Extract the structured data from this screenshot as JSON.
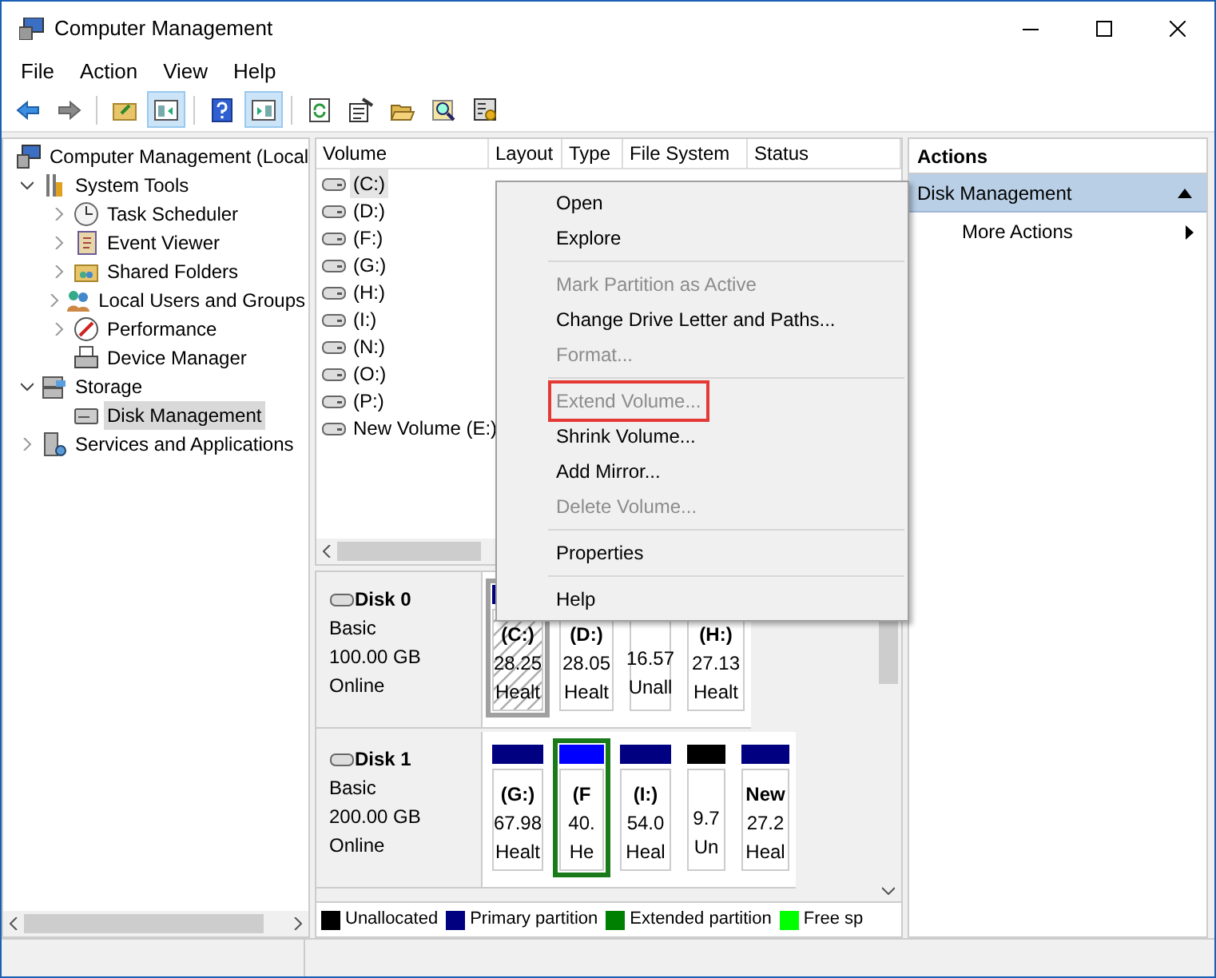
{
  "window": {
    "title": "Computer Management"
  },
  "menu_bar": [
    "File",
    "Action",
    "View",
    "Help"
  ],
  "toolbar": [
    {
      "kind": "back",
      "pressed": false
    },
    {
      "kind": "forward",
      "pressed": false
    },
    {
      "kind": "sep"
    },
    {
      "kind": "up",
      "pressed": false
    },
    {
      "kind": "tree",
      "pressed": true
    },
    {
      "kind": "sep"
    },
    {
      "kind": "help",
      "pressed": false
    },
    {
      "kind": "actionpane",
      "pressed": true
    },
    {
      "kind": "sep"
    },
    {
      "kind": "refresh",
      "pressed": false
    },
    {
      "kind": "properties",
      "pressed": false
    },
    {
      "kind": "open",
      "pressed": false
    },
    {
      "kind": "search",
      "pressed": false
    },
    {
      "kind": "settings",
      "pressed": false
    }
  ],
  "tree": [
    {
      "label": "Computer Management (Local",
      "kind": "computer",
      "selected": false,
      "children": [
        {
          "label": "System Tools",
          "kind": "tools",
          "selected": false,
          "expanded": true,
          "children": [
            {
              "label": "Task Scheduler",
              "kind": "clock",
              "selected": false,
              "expanded": false,
              "has_children": true
            },
            {
              "label": "Event Viewer",
              "kind": "book",
              "selected": false,
              "expanded": false,
              "has_children": true
            },
            {
              "label": "Shared Folders",
              "kind": "folder",
              "selected": false,
              "expanded": false,
              "has_children": true
            },
            {
              "label": "Local Users and Groups",
              "kind": "users",
              "selected": false,
              "expanded": false,
              "has_children": true
            },
            {
              "label": "Performance",
              "kind": "perf",
              "selected": false,
              "expanded": false,
              "has_children": true
            },
            {
              "label": "Device Manager",
              "kind": "device",
              "selected": false,
              "has_children": false
            }
          ]
        },
        {
          "label": "Storage",
          "kind": "storage",
          "selected": false,
          "expanded": true,
          "children": [
            {
              "label": "Disk Management",
              "kind": "disk",
              "selected": true,
              "has_children": false
            }
          ]
        },
        {
          "label": "Services and Applications",
          "kind": "services",
          "selected": false,
          "expanded": false,
          "has_children": true
        }
      ]
    }
  ],
  "volume_table": {
    "columns": [
      "Volume",
      "Layout",
      "Type",
      "File System",
      "Status"
    ],
    "rows": [
      {
        "volume": "(C:)",
        "selected": true
      },
      {
        "volume": "(D:)",
        "selected": false
      },
      {
        "volume": "(F:)",
        "selected": false
      },
      {
        "volume": "(G:)",
        "selected": false
      },
      {
        "volume": "(H:)",
        "selected": false
      },
      {
        "volume": "(I:)",
        "selected": false
      },
      {
        "volume": "(N:)",
        "selected": false
      },
      {
        "volume": "(O:)",
        "selected": false
      },
      {
        "volume": "(P:)",
        "selected": false
      },
      {
        "volume": "New Volume (E:)",
        "selected": false
      }
    ]
  },
  "disks": [
    {
      "name": "Disk 0",
      "type": "Basic",
      "size": "100.00 GB",
      "state": "Online",
      "partitions": [
        {
          "kind": "primary",
          "label": "(C:)",
          "size": "28.25",
          "status": "Healt",
          "selected": true
        },
        {
          "label": "(D:)",
          "size": "28.05",
          "status": "Healt",
          "selected": false
        },
        {
          "size": "16.57",
          "status": "Unall",
          "selected": false
        },
        {
          "label": "(H:)",
          "size": "27.13",
          "status": "Healt",
          "selected": false
        }
      ]
    },
    {
      "name": "Disk 1",
      "type": "Basic",
      "size": "200.00 GB",
      "state": "Online",
      "partitions": [
        {
          "kind": "primary",
          "label": "(G:)",
          "size": "67.98",
          "status": "Healt",
          "selected": false
        },
        {
          "kind": "logical",
          "label": "(F",
          "size": "40.",
          "status": "He",
          "selected": true
        },
        {
          "kind": "primary",
          "label": "(I:)",
          "size": "54.0",
          "status": "Heal",
          "selected": false
        },
        {
          "kind": "unallocated",
          "size": "9.7",
          "status": "Un",
          "selected": false
        },
        {
          "kind": "primary",
          "label": "New",
          "size": "27.2",
          "status": "Heal",
          "selected": false
        }
      ]
    }
  ],
  "legend": [
    {
      "label": "Unallocated",
      "color": "#000000"
    },
    {
      "label": "Primary partition",
      "color": "#000080"
    },
    {
      "label": "Extended partition",
      "color": "#008000"
    },
    {
      "label": "Free sp",
      "color": "#00ff00"
    }
  ],
  "actions": {
    "title": "Actions",
    "section": {
      "label": "Disk Management",
      "expanded": true
    },
    "items": [
      "More Actions"
    ]
  },
  "context_menu": [
    {
      "kind": "item",
      "label": "Open",
      "disabled": false,
      "outlined": false
    },
    {
      "kind": "item",
      "label": "Explore",
      "disabled": false,
      "outlined": false
    },
    {
      "kind": "separator"
    },
    {
      "kind": "item",
      "label": "Mark Partition as Active",
      "disabled": true,
      "outlined": false
    },
    {
      "kind": "item",
      "label": "Change Drive Letter and Paths...",
      "disabled": false,
      "outlined": false
    },
    {
      "kind": "item",
      "label": "Format...",
      "disabled": true,
      "outlined": false
    },
    {
      "kind": "separator"
    },
    {
      "kind": "item",
      "label": "Extend Volume...",
      "disabled": true,
      "outlined": true
    },
    {
      "kind": "item",
      "label": "Shrink Volume...",
      "disabled": false,
      "outlined": false
    },
    {
      "kind": "item",
      "label": "Add Mirror...",
      "disabled": false,
      "outlined": false
    },
    {
      "kind": "item",
      "label": "Delete Volume...",
      "disabled": true,
      "outlined": false
    },
    {
      "kind": "separator"
    },
    {
      "kind": "item",
      "label": "Properties",
      "disabled": false,
      "outlined": false
    },
    {
      "kind": "separator"
    },
    {
      "kind": "item",
      "label": "Help",
      "disabled": false,
      "outlined": false
    }
  ]
}
